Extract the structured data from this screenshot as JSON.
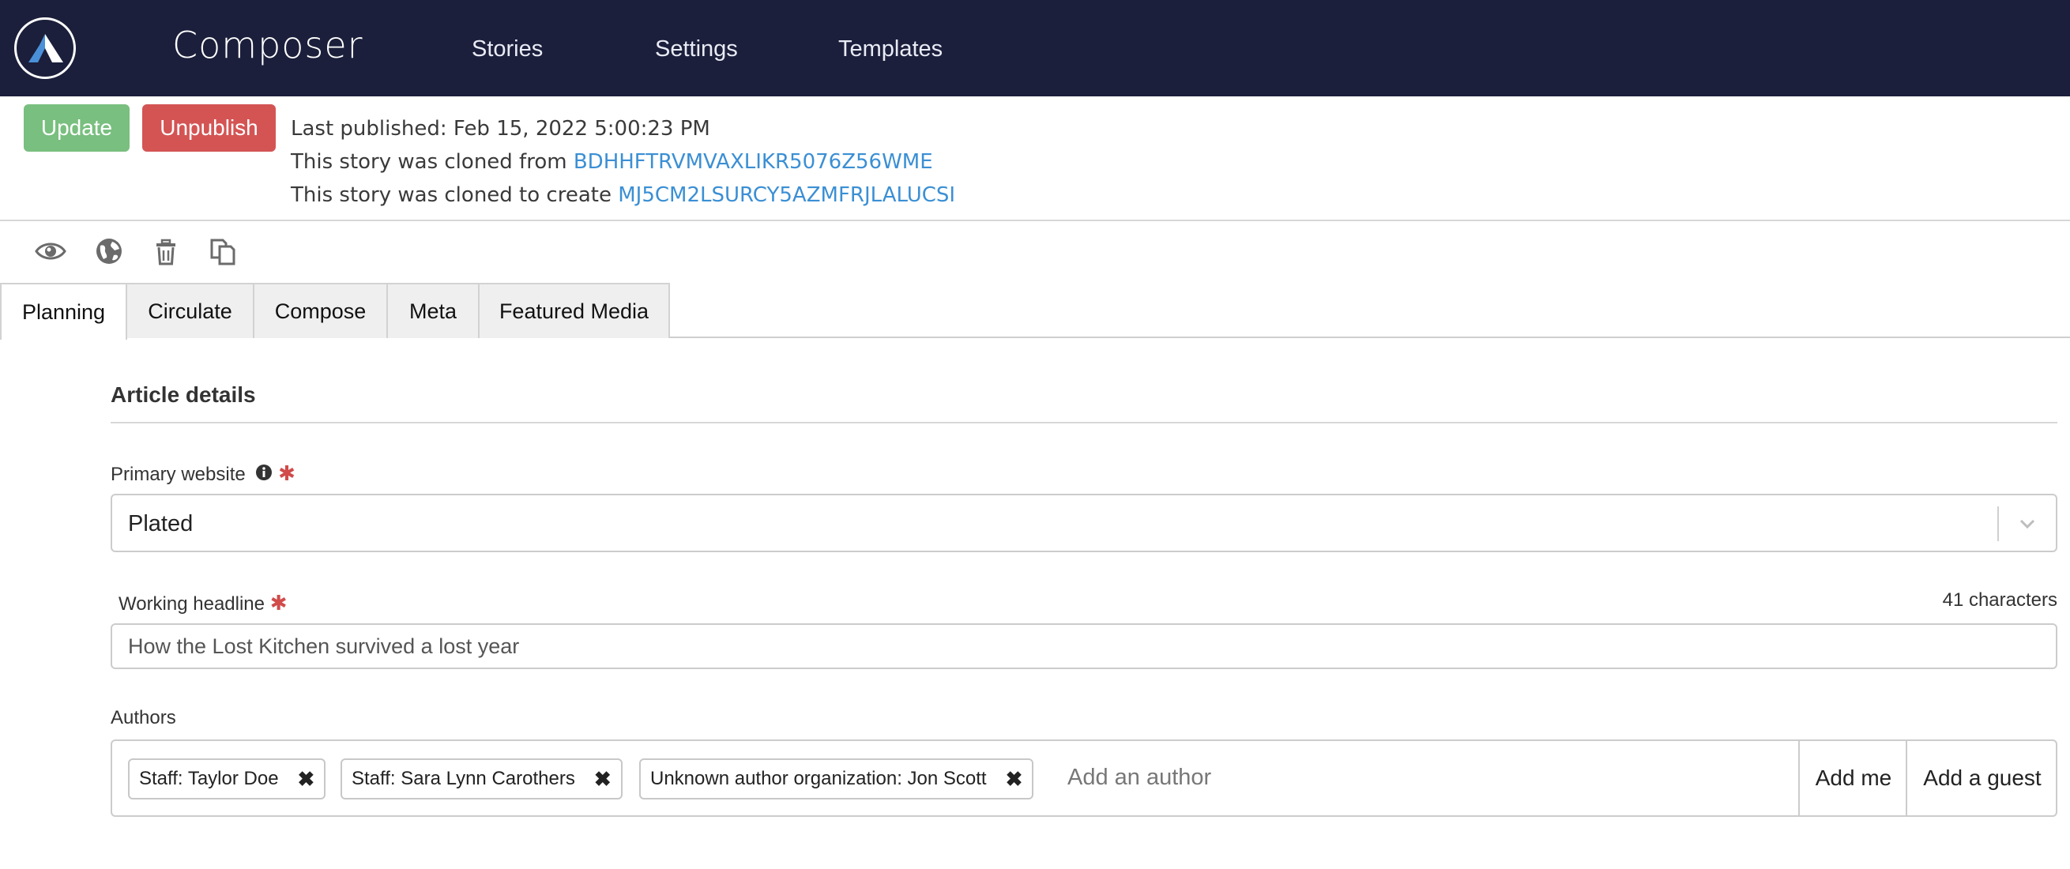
{
  "header": {
    "app_title": "Composer",
    "nav": [
      "Stories",
      "Settings",
      "Templates"
    ]
  },
  "actions": {
    "update_label": "Update",
    "unpublish_label": "Unpublish"
  },
  "publish_info": {
    "last_published": "Last published: Feb 15, 2022 5:00:23 PM",
    "cloned_from_prefix": "This story was cloned from ",
    "cloned_from_id": "BDHHFTRVMVAXLIKR5076Z56WME",
    "cloned_to_prefix": "This story was cloned to create ",
    "cloned_to_id": "MJ5CM2LSURCY5AZMFRJLALUCSI"
  },
  "toolbar_icons": [
    "eye-icon",
    "globe-icon",
    "trash-icon",
    "copy-icon"
  ],
  "tabs": [
    "Planning",
    "Circulate",
    "Compose",
    "Meta",
    "Featured Media"
  ],
  "active_tab": "Planning",
  "form": {
    "section_title": "Article details",
    "primary_website_label": "Primary website",
    "primary_website_value": "Plated",
    "working_headline_label": "Working headline",
    "working_headline_value": "How the Lost Kitchen survived a lost year",
    "char_count": "41 characters",
    "authors_label": "Authors",
    "authors": [
      "Staff: Taylor Doe",
      "Staff: Sara Lynn Carothers",
      "Unknown author organization: Jon Scott"
    ],
    "author_placeholder": "Add an author",
    "add_me_label": "Add me",
    "add_guest_label": "Add a guest"
  },
  "colors": {
    "topbar": "#1b1f3b",
    "update": "#79bf7f",
    "unpublish": "#d45454",
    "link": "#3b8fd4",
    "required": "#d14b4b"
  }
}
